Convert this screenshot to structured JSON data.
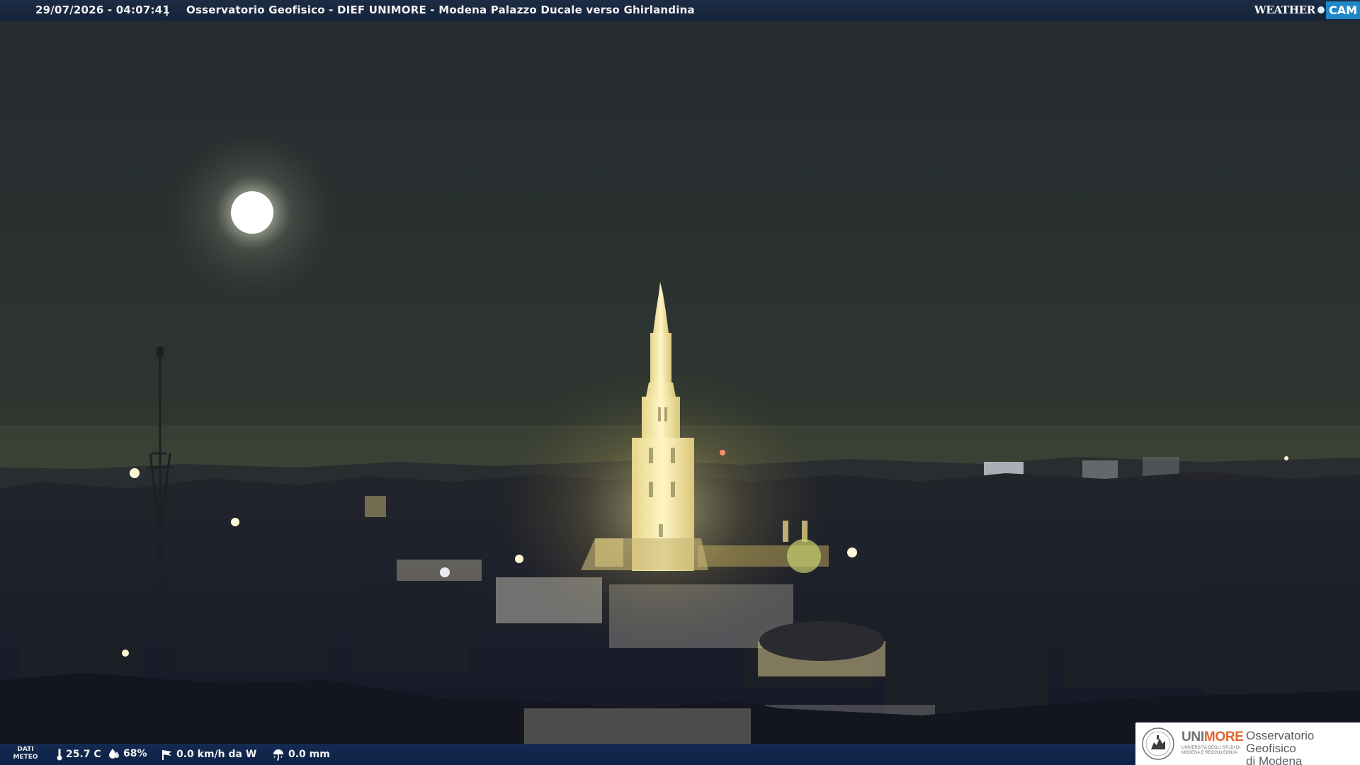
{
  "header": {
    "timestamp": "29/07/2026 - 04:07:41",
    "separator": "|",
    "camera_title": "Osservatorio Geofisico - DIEF UNIMORE - Modena Palazzo Ducale verso Ghirlandina"
  },
  "brand": {
    "weather": "WEATHER",
    "cam": "CAM",
    "colors": {
      "cam_bg": "#1e87c9"
    }
  },
  "weather_bar": {
    "label_line1": "DATI",
    "label_line2": "METEO",
    "temperature": "25.7 C",
    "humidity": "68%",
    "wind": "0.0 km/h da W",
    "rain": "0.0 mm",
    "icons": [
      "thermometer-icon",
      "humidity-drop-icon",
      "wind-icon",
      "rain-umbrella-icon"
    ]
  },
  "footer_logo": {
    "uni_prefix": "UNI",
    "uni_suffix": "MORE",
    "university_line1": "UNIVERSITÀ DEGLI STUDI DI",
    "university_line2": "MODENA E REGGIO EMILIA",
    "observatory_line1": "Osservatorio Geofisico",
    "observatory_line2": "di Modena",
    "colors": {
      "accent": "#e0642b",
      "text": "#6e7175"
    }
  }
}
